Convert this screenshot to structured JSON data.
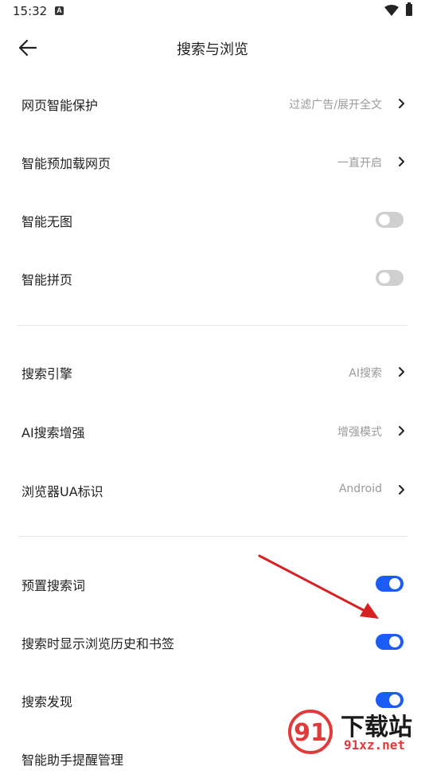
{
  "status_bar": {
    "time": "15:32",
    "notification_glyph": "A"
  },
  "header": {
    "title": "搜索与浏览",
    "back_icon": "arrow-left-icon"
  },
  "rows": [
    {
      "label": "网页智能保护",
      "value": "过滤广告/展开全文",
      "type": "link"
    },
    {
      "label": "智能预加载网页",
      "value": "一直开启",
      "type": "link"
    },
    {
      "label": "智能无图",
      "type": "toggle",
      "on": false
    },
    {
      "label": "智能拼页",
      "type": "toggle",
      "on": false
    },
    {
      "label": "搜索引擎",
      "value": "AI搜索",
      "type": "link"
    },
    {
      "label": "AI搜索增强",
      "value": "增强模式",
      "type": "link"
    },
    {
      "label": "浏览器UA标识",
      "value": "Android",
      "type": "link"
    },
    {
      "label": "预置搜索词",
      "type": "toggle",
      "on": true
    },
    {
      "label": "搜索时显示浏览历史和书签",
      "type": "toggle",
      "on": true
    },
    {
      "label": "搜索发现",
      "type": "toggle",
      "on": true
    },
    {
      "label": "智能助手提醒管理",
      "type": "link"
    }
  ],
  "colors": {
    "accent": "#1a5cf5",
    "toggle_off": "#cfcfcf",
    "annotation_arrow": "#d62222"
  },
  "watermark": {
    "brand": "下载站",
    "domain": "91xz.net"
  }
}
